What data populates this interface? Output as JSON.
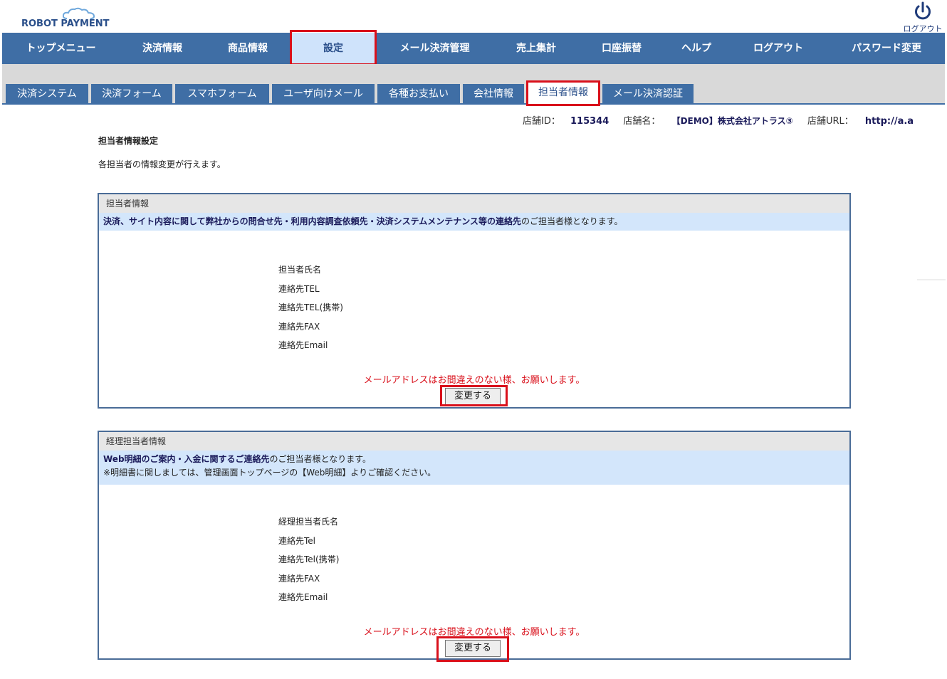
{
  "header": {
    "logo_text": "ROBOT PAYMENT",
    "logout_label": "ログアウト"
  },
  "mainnav": [
    {
      "label": "トップメニュー"
    },
    {
      "label": "決済情報"
    },
    {
      "label": "商品情報"
    },
    {
      "label": "設定"
    },
    {
      "label": "メール決済管理"
    },
    {
      "label": "売上集計"
    },
    {
      "label": "口座振替"
    },
    {
      "label": "ヘルプ"
    },
    {
      "label": "ログアウト"
    },
    {
      "label": "パスワード変更"
    }
  ],
  "subnav": [
    {
      "label": "決済システム"
    },
    {
      "label": "決済フォーム"
    },
    {
      "label": "スマホフォーム"
    },
    {
      "label": "ユーザ向けメール"
    },
    {
      "label": "各種お支払い"
    },
    {
      "label": "会社情報"
    },
    {
      "label": "担当者情報"
    },
    {
      "label": "メール決済認証"
    }
  ],
  "store": {
    "id_label": "店舗ID：",
    "id_value": "115344",
    "name_label": "店舗名：",
    "name_value": "【DEMO】株式会社アトラス③",
    "url_label": "店舗URL：",
    "url_value": "http://a.a"
  },
  "page": {
    "title": "担当者情報設定",
    "description": "各担当者の情報変更が行えます。"
  },
  "panel1": {
    "heading": "担当者情報",
    "note_bold": "決済、サイト内容に関して弊社からの問合せ先・利用内容調査依頼先・決済システムメンテナンス等の連絡先",
    "note_rest": "のご担当者様となります。",
    "fields": [
      "担当者氏名",
      "連絡先TEL",
      "連絡先TEL(携帯)",
      "連絡先FAX",
      "連絡先Email"
    ],
    "warning": "メールアドレスはお間違えのない様、お願いします。",
    "button": "変更する"
  },
  "panel2": {
    "heading": "経理担当者情報",
    "note_bold": "Web明細のご案内・入金に関するご連絡先",
    "note_rest": "のご担当者様となります。",
    "note_line2": "※明細書に関しましては、管理画面トップページの【Web明細】よりご確認ください。",
    "fields": [
      "経理担当者氏名",
      "連絡先Tel",
      "連絡先Tel(携帯)",
      "連絡先FAX",
      "連絡先Email"
    ],
    "warning": "メールアドレスはお間違えのない様、お願いします。",
    "button": "変更する"
  },
  "colors": {
    "nav_blue": "#3f6ea5",
    "active_tab": "#cfe3fb",
    "highlight_red": "#d9101b",
    "note_bg": "#d3e6fb"
  }
}
